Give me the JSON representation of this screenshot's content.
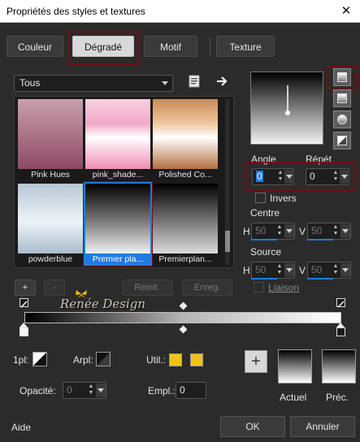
{
  "window": {
    "title": "Propriétés des styles et textures",
    "close_glyph": "✕"
  },
  "tabs": [
    {
      "label": "Couleur"
    },
    {
      "label": "Dégradé",
      "active": true
    },
    {
      "label": "Motif"
    },
    {
      "label": "Texture"
    }
  ],
  "category_select": {
    "value": "Tous"
  },
  "gallery": {
    "items": [
      {
        "label": "Pink Hues"
      },
      {
        "label": "pink_shade..."
      },
      {
        "label": "Polished Co..."
      },
      {
        "label": "powderblue"
      },
      {
        "label": "Premier pla...",
        "selected": true
      },
      {
        "label": "Premierplan..."
      }
    ]
  },
  "buttons": {
    "add": "+",
    "remove": "-",
    "reset": "Réinit.",
    "save": "Enreg.",
    "ok": "OK",
    "cancel": "Annuler",
    "help": "Aide"
  },
  "watermark": "Renée Design",
  "angle": {
    "label": "Angle",
    "value": "0"
  },
  "repeat": {
    "label": "Répét.",
    "value": "0"
  },
  "invert": {
    "label": "Invers"
  },
  "center": {
    "label": "Centre",
    "h_label": "H",
    "h_value": "50",
    "v_label": "V",
    "v_value": "50"
  },
  "source": {
    "label": "Source",
    "h_label": "H",
    "h_value": "50",
    "v_label": "V",
    "v_value": "50"
  },
  "link": {
    "label": "Liaison"
  },
  "bottom": {
    "onepl_label": "1pl:",
    "arpl_label": "Arpl:",
    "util_label": "Util.:",
    "opacity_label": "Opacité:",
    "opacity_value": "0",
    "empl_label": "Empl.:",
    "empl_value": "0"
  },
  "previews": {
    "current_label": "Actuel",
    "previous_label": "Préc."
  },
  "colors": {
    "accent": "#1f7be0",
    "highlight_box": "#6e0f12",
    "util_swatch": "#f2c21a"
  }
}
